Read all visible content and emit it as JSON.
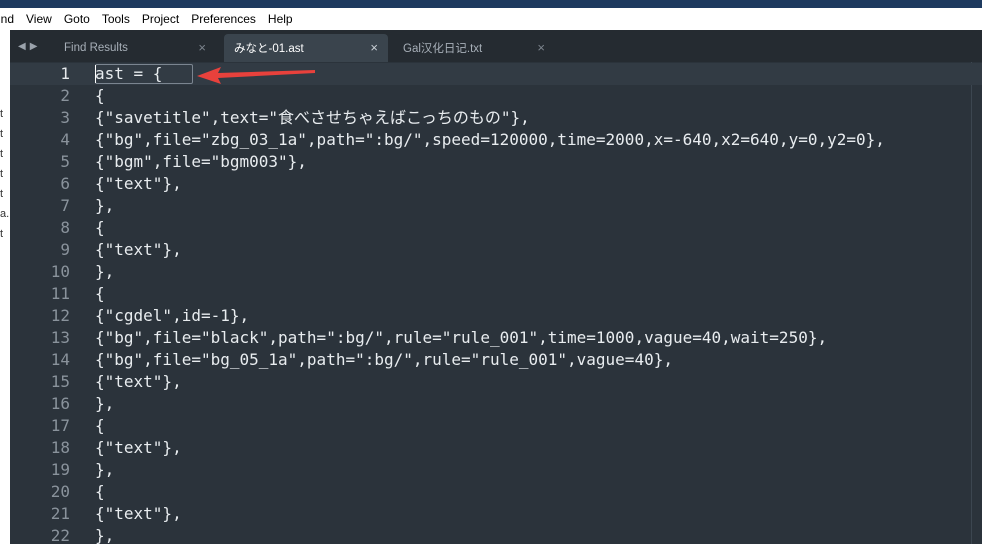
{
  "menu": {
    "items": [
      "ind",
      "View",
      "Goto",
      "Tools",
      "Project",
      "Preferences",
      "Help"
    ]
  },
  "left_panel": {
    "fragments": [
      "t",
      "t",
      "t",
      "t",
      "t",
      "a.",
      "t"
    ]
  },
  "tabs": [
    {
      "label": "Find Results",
      "active": false
    },
    {
      "label": "みなと-01.ast",
      "active": true
    },
    {
      "label": "Gal汉化日记.txt",
      "active": false
    },
    {
      "label": "",
      "active": false
    }
  ],
  "editor": {
    "current_line": 1,
    "lines": [
      {
        "num": "1",
        "text": "ast = {"
      },
      {
        "num": "2",
        "text": "{"
      },
      {
        "num": "3",
        "text": "{\"savetitle\",text=\"食べさせちゃえばこっちのもの\"},"
      },
      {
        "num": "4",
        "text": "{\"bg\",file=\"zbg_03_1a\",path=\":bg/\",speed=120000,time=2000,x=-640,x2=640,y=0,y2=0},"
      },
      {
        "num": "5",
        "text": "{\"bgm\",file=\"bgm003\"},"
      },
      {
        "num": "6",
        "text": "{\"text\"},"
      },
      {
        "num": "7",
        "text": "},"
      },
      {
        "num": "8",
        "text": "{"
      },
      {
        "num": "9",
        "text": "{\"text\"},"
      },
      {
        "num": "10",
        "text": "},"
      },
      {
        "num": "11",
        "text": "{"
      },
      {
        "num": "12",
        "text": "{\"cgdel\",id=-1},"
      },
      {
        "num": "13",
        "text": "{\"bg\",file=\"black\",path=\":bg/\",rule=\"rule_001\",time=1000,vague=40,wait=250},"
      },
      {
        "num": "14",
        "text": "{\"bg\",file=\"bg_05_1a\",path=\":bg/\",rule=\"rule_001\",vague=40},"
      },
      {
        "num": "15",
        "text": "{\"text\"},"
      },
      {
        "num": "16",
        "text": "},"
      },
      {
        "num": "17",
        "text": "{"
      },
      {
        "num": "18",
        "text": "{\"text\"},"
      },
      {
        "num": "19",
        "text": "},"
      },
      {
        "num": "20",
        "text": "{"
      },
      {
        "num": "21",
        "text": "{\"text\"},"
      },
      {
        "num": "22",
        "text": "},"
      }
    ]
  },
  "annotation": {
    "color": "#e8413c"
  },
  "colors": {
    "background": "#2b333b",
    "tabbar": "#252b31",
    "active_tab": "#3a444d"
  }
}
